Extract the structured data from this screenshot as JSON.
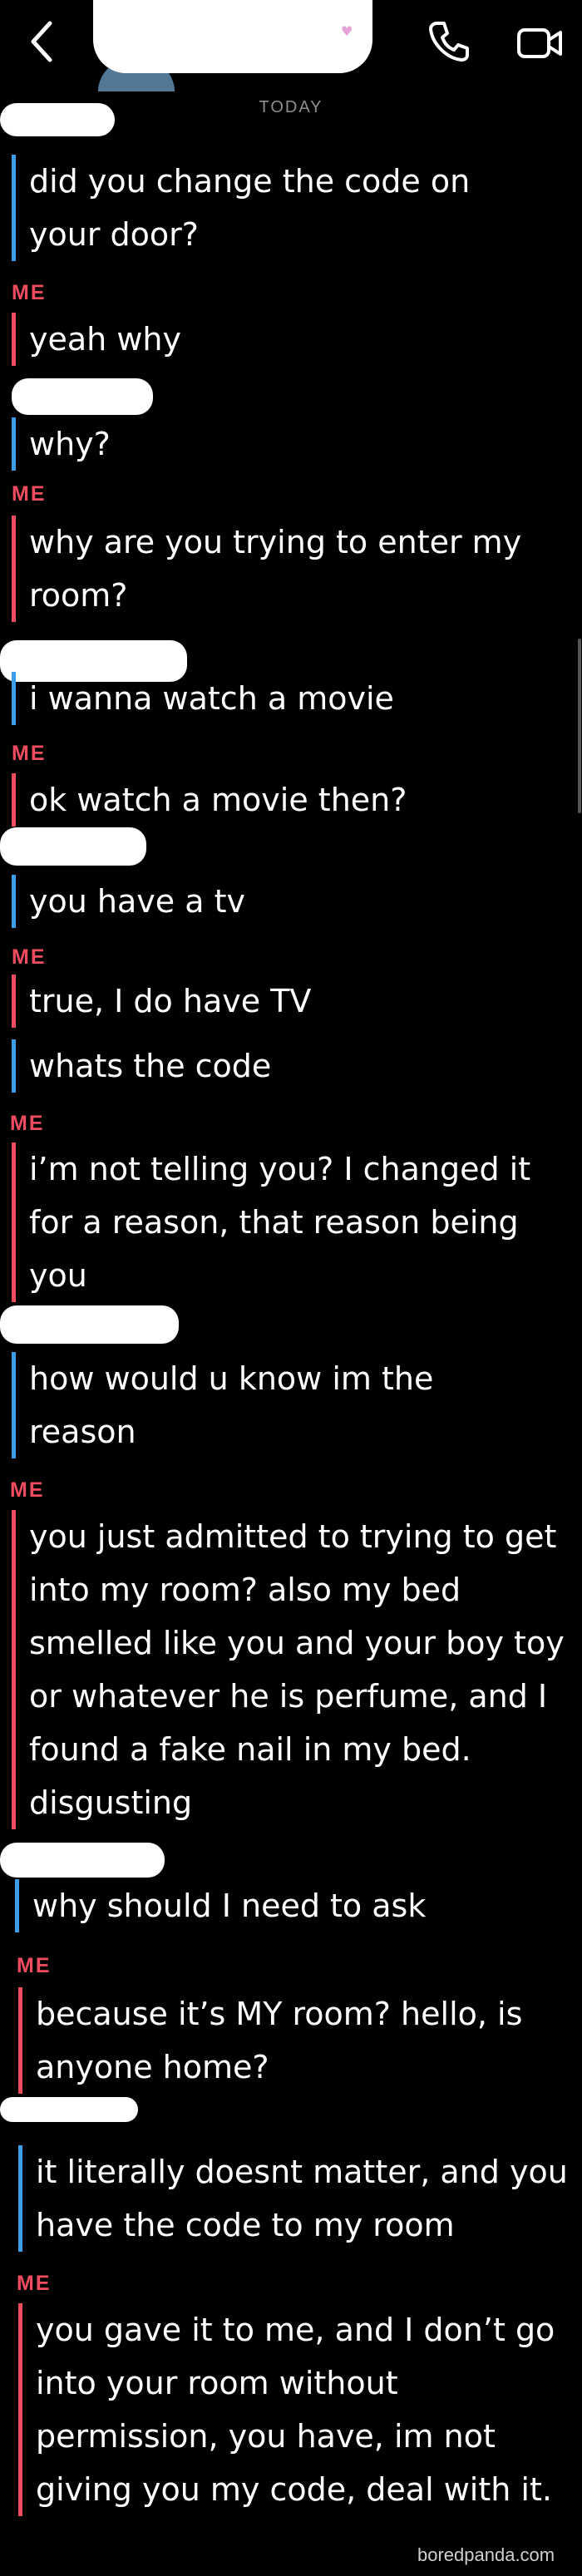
{
  "header": {
    "back_icon": "chevron-left-icon",
    "call_icon": "phone-icon",
    "video_icon": "video-camera-icon"
  },
  "divider": {
    "today": "TODAY"
  },
  "me_label": "ME",
  "messages": [
    {
      "from": "them",
      "text": "did you change the code on your door?"
    },
    {
      "from": "me",
      "text": "yeah why"
    },
    {
      "from": "them",
      "text": "why?"
    },
    {
      "from": "me",
      "text": "why are you trying to enter my room?"
    },
    {
      "from": "them",
      "text": "i wanna watch a movie"
    },
    {
      "from": "me",
      "text": "ok watch a movie then?"
    },
    {
      "from": "them",
      "text": "you have a tv"
    },
    {
      "from": "me",
      "text": "true, I do have TV"
    },
    {
      "from": "them",
      "text": "whats the code"
    },
    {
      "from": "me",
      "text": "i’m not telling you? I changed it for a reason, that reason being you"
    },
    {
      "from": "them",
      "text": "how would u know im the reason"
    },
    {
      "from": "me",
      "text": "you just admitted to trying to get into my room? also my bed smelled like you and your boy toy or whatever he is perfume, and I found a fake nail in my bed. disgusting"
    },
    {
      "from": "them",
      "text": "why should I need to ask"
    },
    {
      "from": "me",
      "text": "because it’s MY room? hello, is anyone home?"
    },
    {
      "from": "them",
      "text": "it literally doesnt matter, and you have the code to my room"
    },
    {
      "from": "me",
      "text": "you gave it to me, and I don’t go into your room without permission, you have, im not giving you my code, deal with it."
    }
  ],
  "watermark": "boredpanda.com"
}
